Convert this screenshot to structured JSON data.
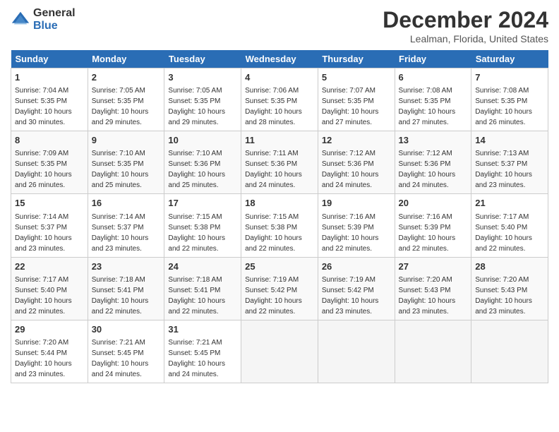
{
  "header": {
    "logo_general": "General",
    "logo_blue": "Blue",
    "title": "December 2024",
    "location": "Lealman, Florida, United States"
  },
  "calendar": {
    "days_of_week": [
      "Sunday",
      "Monday",
      "Tuesday",
      "Wednesday",
      "Thursday",
      "Friday",
      "Saturday"
    ],
    "weeks": [
      [
        {
          "day": "1",
          "info": "Sunrise: 7:04 AM\nSunset: 5:35 PM\nDaylight: 10 hours\nand 30 minutes."
        },
        {
          "day": "2",
          "info": "Sunrise: 7:05 AM\nSunset: 5:35 PM\nDaylight: 10 hours\nand 29 minutes."
        },
        {
          "day": "3",
          "info": "Sunrise: 7:05 AM\nSunset: 5:35 PM\nDaylight: 10 hours\nand 29 minutes."
        },
        {
          "day": "4",
          "info": "Sunrise: 7:06 AM\nSunset: 5:35 PM\nDaylight: 10 hours\nand 28 minutes."
        },
        {
          "day": "5",
          "info": "Sunrise: 7:07 AM\nSunset: 5:35 PM\nDaylight: 10 hours\nand 27 minutes."
        },
        {
          "day": "6",
          "info": "Sunrise: 7:08 AM\nSunset: 5:35 PM\nDaylight: 10 hours\nand 27 minutes."
        },
        {
          "day": "7",
          "info": "Sunrise: 7:08 AM\nSunset: 5:35 PM\nDaylight: 10 hours\nand 26 minutes."
        }
      ],
      [
        {
          "day": "8",
          "info": "Sunrise: 7:09 AM\nSunset: 5:35 PM\nDaylight: 10 hours\nand 26 minutes."
        },
        {
          "day": "9",
          "info": "Sunrise: 7:10 AM\nSunset: 5:35 PM\nDaylight: 10 hours\nand 25 minutes."
        },
        {
          "day": "10",
          "info": "Sunrise: 7:10 AM\nSunset: 5:36 PM\nDaylight: 10 hours\nand 25 minutes."
        },
        {
          "day": "11",
          "info": "Sunrise: 7:11 AM\nSunset: 5:36 PM\nDaylight: 10 hours\nand 24 minutes."
        },
        {
          "day": "12",
          "info": "Sunrise: 7:12 AM\nSunset: 5:36 PM\nDaylight: 10 hours\nand 24 minutes."
        },
        {
          "day": "13",
          "info": "Sunrise: 7:12 AM\nSunset: 5:36 PM\nDaylight: 10 hours\nand 24 minutes."
        },
        {
          "day": "14",
          "info": "Sunrise: 7:13 AM\nSunset: 5:37 PM\nDaylight: 10 hours\nand 23 minutes."
        }
      ],
      [
        {
          "day": "15",
          "info": "Sunrise: 7:14 AM\nSunset: 5:37 PM\nDaylight: 10 hours\nand 23 minutes."
        },
        {
          "day": "16",
          "info": "Sunrise: 7:14 AM\nSunset: 5:37 PM\nDaylight: 10 hours\nand 23 minutes."
        },
        {
          "day": "17",
          "info": "Sunrise: 7:15 AM\nSunset: 5:38 PM\nDaylight: 10 hours\nand 22 minutes."
        },
        {
          "day": "18",
          "info": "Sunrise: 7:15 AM\nSunset: 5:38 PM\nDaylight: 10 hours\nand 22 minutes."
        },
        {
          "day": "19",
          "info": "Sunrise: 7:16 AM\nSunset: 5:39 PM\nDaylight: 10 hours\nand 22 minutes."
        },
        {
          "day": "20",
          "info": "Sunrise: 7:16 AM\nSunset: 5:39 PM\nDaylight: 10 hours\nand 22 minutes."
        },
        {
          "day": "21",
          "info": "Sunrise: 7:17 AM\nSunset: 5:40 PM\nDaylight: 10 hours\nand 22 minutes."
        }
      ],
      [
        {
          "day": "22",
          "info": "Sunrise: 7:17 AM\nSunset: 5:40 PM\nDaylight: 10 hours\nand 22 minutes."
        },
        {
          "day": "23",
          "info": "Sunrise: 7:18 AM\nSunset: 5:41 PM\nDaylight: 10 hours\nand 22 minutes."
        },
        {
          "day": "24",
          "info": "Sunrise: 7:18 AM\nSunset: 5:41 PM\nDaylight: 10 hours\nand 22 minutes."
        },
        {
          "day": "25",
          "info": "Sunrise: 7:19 AM\nSunset: 5:42 PM\nDaylight: 10 hours\nand 22 minutes."
        },
        {
          "day": "26",
          "info": "Sunrise: 7:19 AM\nSunset: 5:42 PM\nDaylight: 10 hours\nand 23 minutes."
        },
        {
          "day": "27",
          "info": "Sunrise: 7:20 AM\nSunset: 5:43 PM\nDaylight: 10 hours\nand 23 minutes."
        },
        {
          "day": "28",
          "info": "Sunrise: 7:20 AM\nSunset: 5:43 PM\nDaylight: 10 hours\nand 23 minutes."
        }
      ],
      [
        {
          "day": "29",
          "info": "Sunrise: 7:20 AM\nSunset: 5:44 PM\nDaylight: 10 hours\nand 23 minutes."
        },
        {
          "day": "30",
          "info": "Sunrise: 7:21 AM\nSunset: 5:45 PM\nDaylight: 10 hours\nand 24 minutes."
        },
        {
          "day": "31",
          "info": "Sunrise: 7:21 AM\nSunset: 5:45 PM\nDaylight: 10 hours\nand 24 minutes."
        },
        {
          "day": "",
          "info": ""
        },
        {
          "day": "",
          "info": ""
        },
        {
          "day": "",
          "info": ""
        },
        {
          "day": "",
          "info": ""
        }
      ]
    ]
  }
}
